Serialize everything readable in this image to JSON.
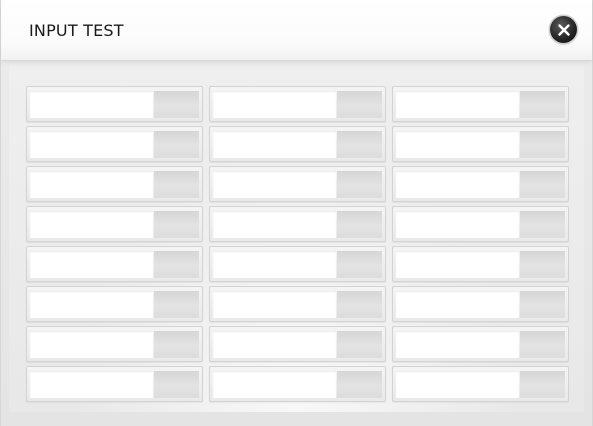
{
  "dialog": {
    "title": "INPUT TEST",
    "close_icon": "close-icon"
  },
  "form": {
    "columns": 3,
    "rows": 8,
    "fields": [
      {
        "value": "",
        "placeholder": ""
      },
      {
        "value": "",
        "placeholder": ""
      },
      {
        "value": "",
        "placeholder": ""
      },
      {
        "value": "",
        "placeholder": ""
      },
      {
        "value": "",
        "placeholder": ""
      },
      {
        "value": "",
        "placeholder": ""
      },
      {
        "value": "",
        "placeholder": ""
      },
      {
        "value": "",
        "placeholder": ""
      },
      {
        "value": "",
        "placeholder": ""
      },
      {
        "value": "",
        "placeholder": ""
      },
      {
        "value": "",
        "placeholder": ""
      },
      {
        "value": "",
        "placeholder": ""
      },
      {
        "value": "",
        "placeholder": ""
      },
      {
        "value": "",
        "placeholder": ""
      },
      {
        "value": "",
        "placeholder": ""
      },
      {
        "value": "",
        "placeholder": ""
      },
      {
        "value": "",
        "placeholder": ""
      },
      {
        "value": "",
        "placeholder": ""
      },
      {
        "value": "",
        "placeholder": ""
      },
      {
        "value": "",
        "placeholder": ""
      },
      {
        "value": "",
        "placeholder": ""
      },
      {
        "value": "",
        "placeholder": ""
      },
      {
        "value": "",
        "placeholder": ""
      },
      {
        "value": "",
        "placeholder": ""
      }
    ]
  },
  "colors": {
    "header_bg": "#ffffff",
    "body_bg": "#e8e8e8",
    "close_button": "#1c1c1c",
    "input_bg": "#ffffff",
    "input_side": "#d9d9d9"
  }
}
